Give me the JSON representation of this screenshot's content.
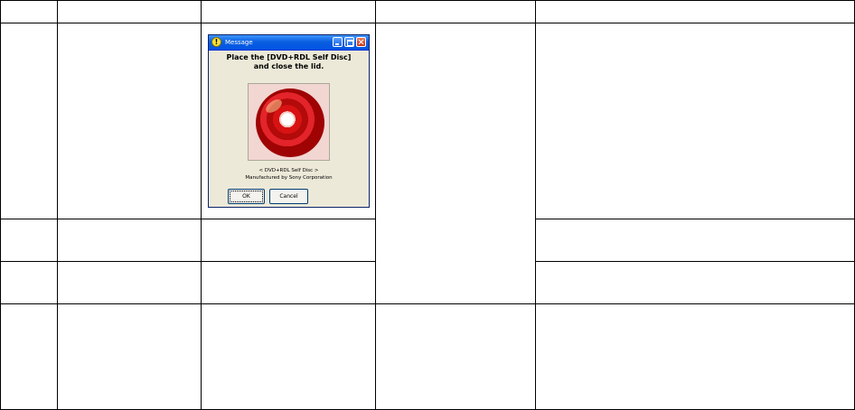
{
  "dialog": {
    "title": "Message",
    "message_line1": "Place the [DVD+RDL Self Disc]",
    "message_line2": "and close the lid.",
    "caption_line1": "< DVD+RDL Self Disc >",
    "caption_line2": "Manufactured by Sony Corporation",
    "ok_label": "OK",
    "cancel_label": "Cancel"
  },
  "colors": {
    "titlebar": "#0054e3",
    "dialog_bg": "#ece9d8",
    "disc_red": "#d81212"
  },
  "icons": [
    "warning-icon",
    "minimize-icon",
    "maximize-icon",
    "close-icon",
    "disc-image"
  ]
}
